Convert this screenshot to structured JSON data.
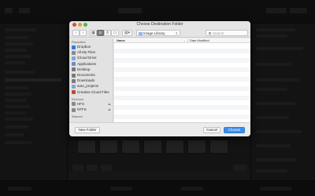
{
  "dialog": {
    "title": "Choose Destination Folder",
    "location": "Image Library",
    "search_placeholder": "Search",
    "columns": {
      "name": "Name",
      "date_modified": "Date Modified"
    },
    "buttons": {
      "new_folder": "New Folder",
      "cancel": "Cancel",
      "choose": "Choose"
    }
  },
  "sidebar": {
    "sections": [
      {
        "heading": "Favorites",
        "items": [
          {
            "label": "Dropbox",
            "icon": "dropbox-icon",
            "color": "#2f7bd8"
          },
          {
            "label": "All My Files",
            "icon": "all-files-icon",
            "color": "#8a8a8a"
          },
          {
            "label": "iCloud Drive",
            "icon": "cloud-icon",
            "color": "#7fa8d8"
          },
          {
            "label": "Applications",
            "icon": "applications-icon",
            "color": "#6d8fc2"
          },
          {
            "label": "Desktop",
            "icon": "desktop-icon",
            "color": "#7a7a7a"
          },
          {
            "label": "Documents",
            "icon": "documents-icon",
            "color": "#7a7a7a"
          },
          {
            "label": "Downloads",
            "icon": "downloads-icon",
            "color": "#7a7a7a"
          },
          {
            "label": "auto_projects",
            "icon": "folder-icon",
            "color": "#7fa8d8"
          },
          {
            "label": "Creative Cloud Files",
            "icon": "creative-cloud-icon",
            "color": "#c04a3a"
          }
        ]
      },
      {
        "heading": "Devices",
        "items": [
          {
            "label": "HFS",
            "icon": "drive-icon",
            "color": "#8a8a8a",
            "eject": true
          },
          {
            "label": "NTFS",
            "icon": "drive-icon",
            "color": "#8a8a8a",
            "eject": true
          }
        ]
      },
      {
        "heading": "Shared",
        "items": []
      }
    ]
  },
  "colors": {
    "accent": "#3d8ef0"
  }
}
